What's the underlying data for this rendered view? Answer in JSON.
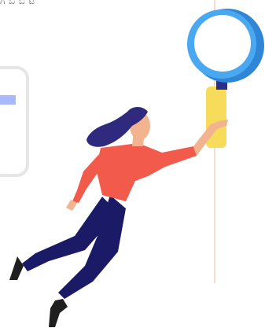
{
  "header": {
    "cropped_text": "ಗ ಬ ಬ ಟ"
  },
  "illustration": {
    "subject": "woman-reaching-for-magnifying-glass",
    "colors": {
      "hair": "#2f2a7e",
      "skin": "#f2b48f",
      "shirt": "#f25b4b",
      "pants": "#1a1a66",
      "shoes": "#1f1f1f",
      "lens_ring": "#4aa8f0",
      "lens_ring_dark": "#2f86d6",
      "handle": "#f6dc5a",
      "handle_band": "#2d2d8a",
      "card_border": "#e6e6e6",
      "card_bar": "#a9b9ff",
      "string": "#f6dccf"
    }
  }
}
